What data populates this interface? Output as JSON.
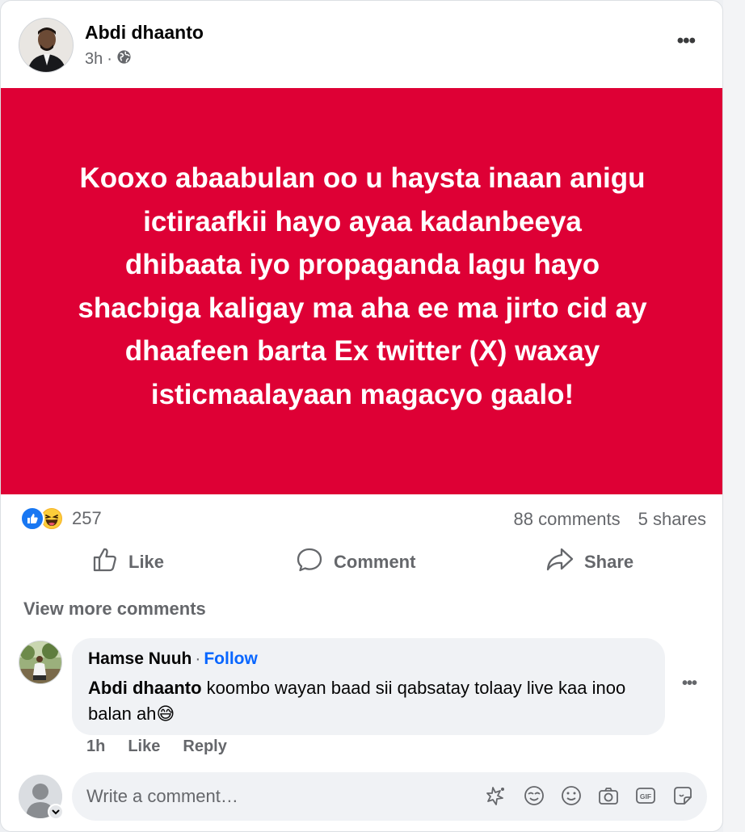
{
  "post": {
    "author": "Abdi dhaanto",
    "time": "3h",
    "separator": "·",
    "privacy_icon": "globe-icon",
    "more_icon": "more-horizontal-icon",
    "more_label": "•••"
  },
  "banner": {
    "text": "Kooxo abaabulan oo u haysta inaan anigu\nictiraafkii hayo ayaa kadanbeeya\ndhibaata iyo       propaganda lagu hayo\nshacbiga kaligay ma aha ee ma jirto cid ay\ndhaafeen barta Ex twitter (X) waxay\nisticmaalayaan magacyo gaalo!",
    "background": "#de0035",
    "text_color": "#ffffff"
  },
  "stats": {
    "reactions": [
      "like-reaction-icon",
      "haha-reaction-icon"
    ],
    "reaction_count": "257",
    "comments": "88 comments",
    "shares": "5 shares"
  },
  "actions": {
    "like": "Like",
    "comment": "Comment",
    "share": "Share"
  },
  "view_more": "View more comments",
  "comment": {
    "name": "Hamse Nuuh",
    "dot": "·",
    "follow": "Follow",
    "mention": "Abdi dhaanto",
    "text": " koombo wayan baad sii qabsatay tolaay live kaa inoo balan ah😅",
    "time": "1h",
    "like": "Like",
    "reply": "Reply",
    "more_label": "•••"
  },
  "composer": {
    "placeholder": "Write a comment…",
    "icons": [
      "sticker-avatar-icon",
      "emoji-face-icon",
      "smile-icon",
      "camera-icon",
      "gif-icon",
      "sticker-icon"
    ]
  },
  "colors": {
    "accent": "#0866ff",
    "like_blue": "#1877f2",
    "muted_text": "#65676b"
  }
}
